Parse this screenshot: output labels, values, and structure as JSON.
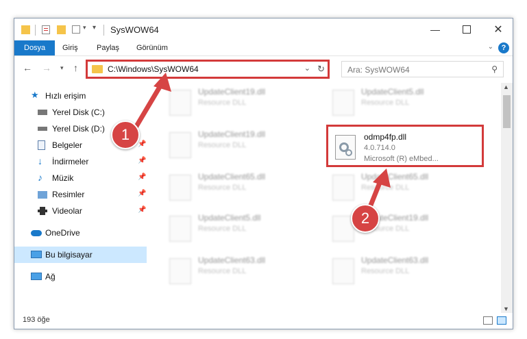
{
  "window": {
    "title": "SysWOW64"
  },
  "ribbon": {
    "tabs": [
      {
        "label": "Dosya",
        "active": true
      },
      {
        "label": "Giriş"
      },
      {
        "label": "Paylaş"
      },
      {
        "label": "Görünüm"
      }
    ],
    "help": "?"
  },
  "nav": {
    "address": "C:\\Windows\\SysWOW64",
    "search_placeholder": "Ara: SysWOW64"
  },
  "sidebar": {
    "items": [
      {
        "label": "Hızlı erişim",
        "icon": "star-icon"
      },
      {
        "label": "Yerel Disk (C:)",
        "icon": "drive-icon"
      },
      {
        "label": "Yerel Disk (D:)",
        "icon": "drive-icon"
      },
      {
        "label": "Belgeler",
        "icon": "documents-icon"
      },
      {
        "label": "İndirmeler",
        "icon": "download-icon"
      },
      {
        "label": "Müzik",
        "icon": "music-icon"
      },
      {
        "label": "Resimler",
        "icon": "pictures-icon"
      },
      {
        "label": "Videolar",
        "icon": "video-icon"
      },
      {
        "label": "OneDrive",
        "icon": "cloud-icon"
      },
      {
        "label": "Bu bilgisayar",
        "icon": "computer-icon"
      },
      {
        "label": "Ağ",
        "icon": "network-icon"
      }
    ]
  },
  "files": {
    "left": [
      {
        "name": "UpdateClient19.dll",
        "desc": "Resource DLL"
      },
      {
        "name": "UpdateClient19.dll",
        "desc": "Resource DLL"
      },
      {
        "name": "UpdateClient65.dll",
        "desc": "Resource DLL"
      },
      {
        "name": "UpdateClient5.dll",
        "desc": "Resource DLL"
      },
      {
        "name": "UpdateClient63.dll",
        "desc": "Resource DLL"
      }
    ],
    "right": [
      {
        "name": "UpdateClient5.dll",
        "desc": "Resource DLL"
      },
      {
        "name": "UpdateClient65.dll",
        "desc": "Resource DLL"
      },
      {
        "name": "UpdateClient19.dll",
        "desc": "Resource DLL"
      },
      {
        "name": "UpdateClient63.dll",
        "desc": "Resource DLL"
      }
    ],
    "highlighted": {
      "name": "odmp4fp.dll",
      "version": "4.0.714.0",
      "company": "Microsoft (R) eMbed..."
    }
  },
  "status": {
    "count": "193 öğe"
  },
  "annotations": {
    "step1": "1",
    "step2": "2"
  },
  "colors": {
    "accent": "#1979ca",
    "highlight": "#d33a3a",
    "selected": "#cce8ff"
  }
}
